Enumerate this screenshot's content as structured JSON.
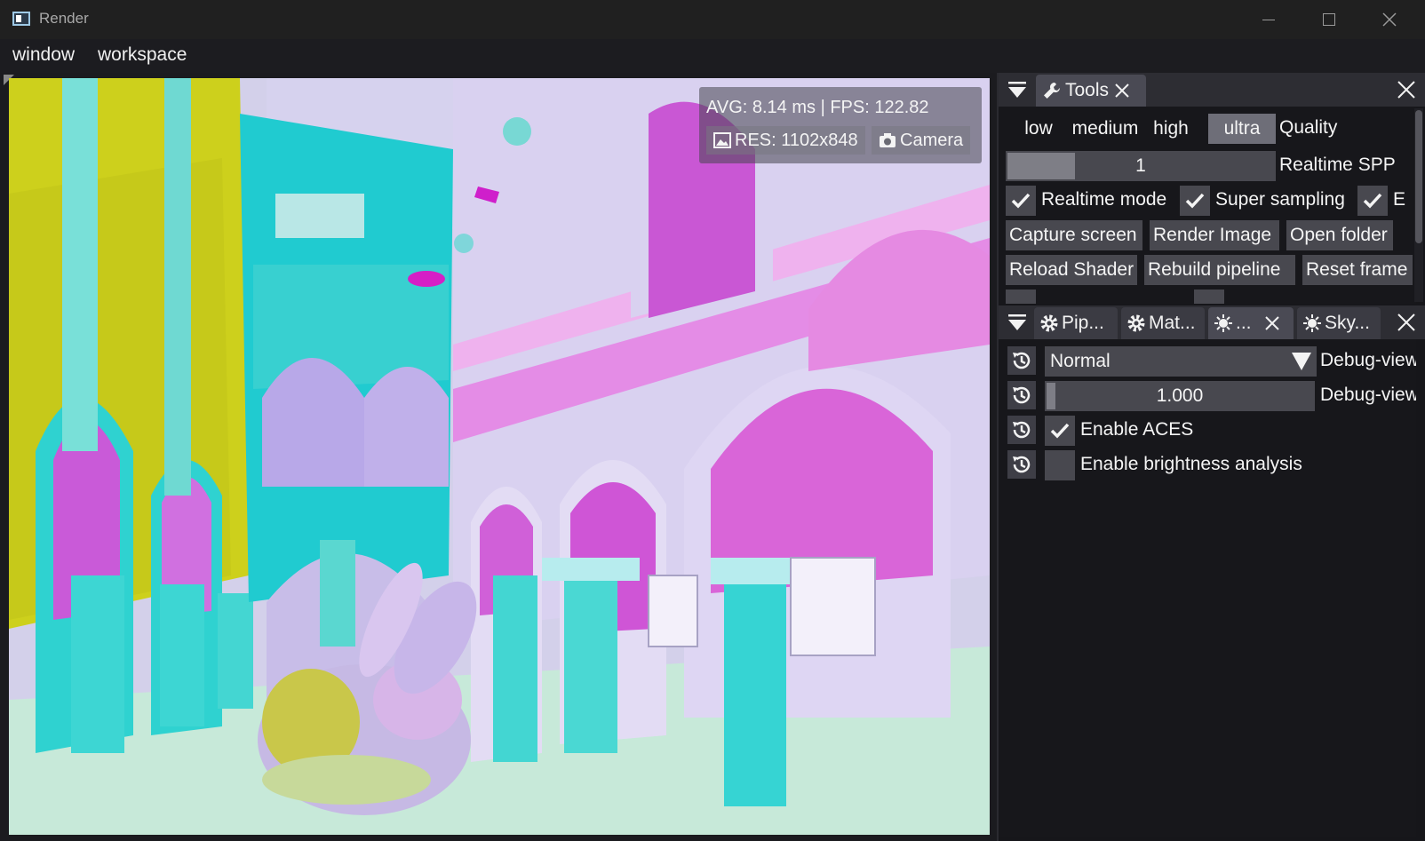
{
  "window": {
    "title": "Render"
  },
  "menu": {
    "items": [
      "window",
      "workspace"
    ]
  },
  "stats": {
    "avg_fps": "AVG: 8.14 ms | FPS: 122.82",
    "res": "RES: 1102x848",
    "camera": "Camera"
  },
  "tools_panel": {
    "tab_label": "Tools",
    "quality_options": [
      "low",
      "medium",
      "high",
      "ultra"
    ],
    "quality_selected": "ultra",
    "quality_label": "Quality",
    "spp_value": "1",
    "spp_label": "Realtime SPP",
    "checks": [
      {
        "label": "Realtime mode",
        "checked": true
      },
      {
        "label": "Super sampling",
        "checked": true
      },
      {
        "label": "E",
        "checked": true
      }
    ],
    "buttons_row1": [
      "Capture screen",
      "Render Image",
      "Open folder"
    ],
    "buttons_row2": [
      "Reload Shader",
      "Rebuild pipeline",
      "Reset frame"
    ]
  },
  "pipeline_panel": {
    "tabs": [
      "Pip...",
      "Mat...",
      "...",
      "Sky..."
    ],
    "debug_view_value": "Normal",
    "debug_view_label": "Debug-view",
    "debug_scale_value": "1.000",
    "debug_scale_label": "Debug-view",
    "enable_aces_label": "Enable ACES",
    "enable_aces_checked": true,
    "enable_brightness_label": "Enable brightness analysis",
    "enable_brightness_checked": false
  },
  "colors": {
    "accent": "#6e6e78",
    "panel": "#16161a",
    "cyan": "#2ad4d6",
    "magenta": "#d83bd4",
    "yellow": "#cfd21a",
    "lavender": "#d9d3ee"
  }
}
